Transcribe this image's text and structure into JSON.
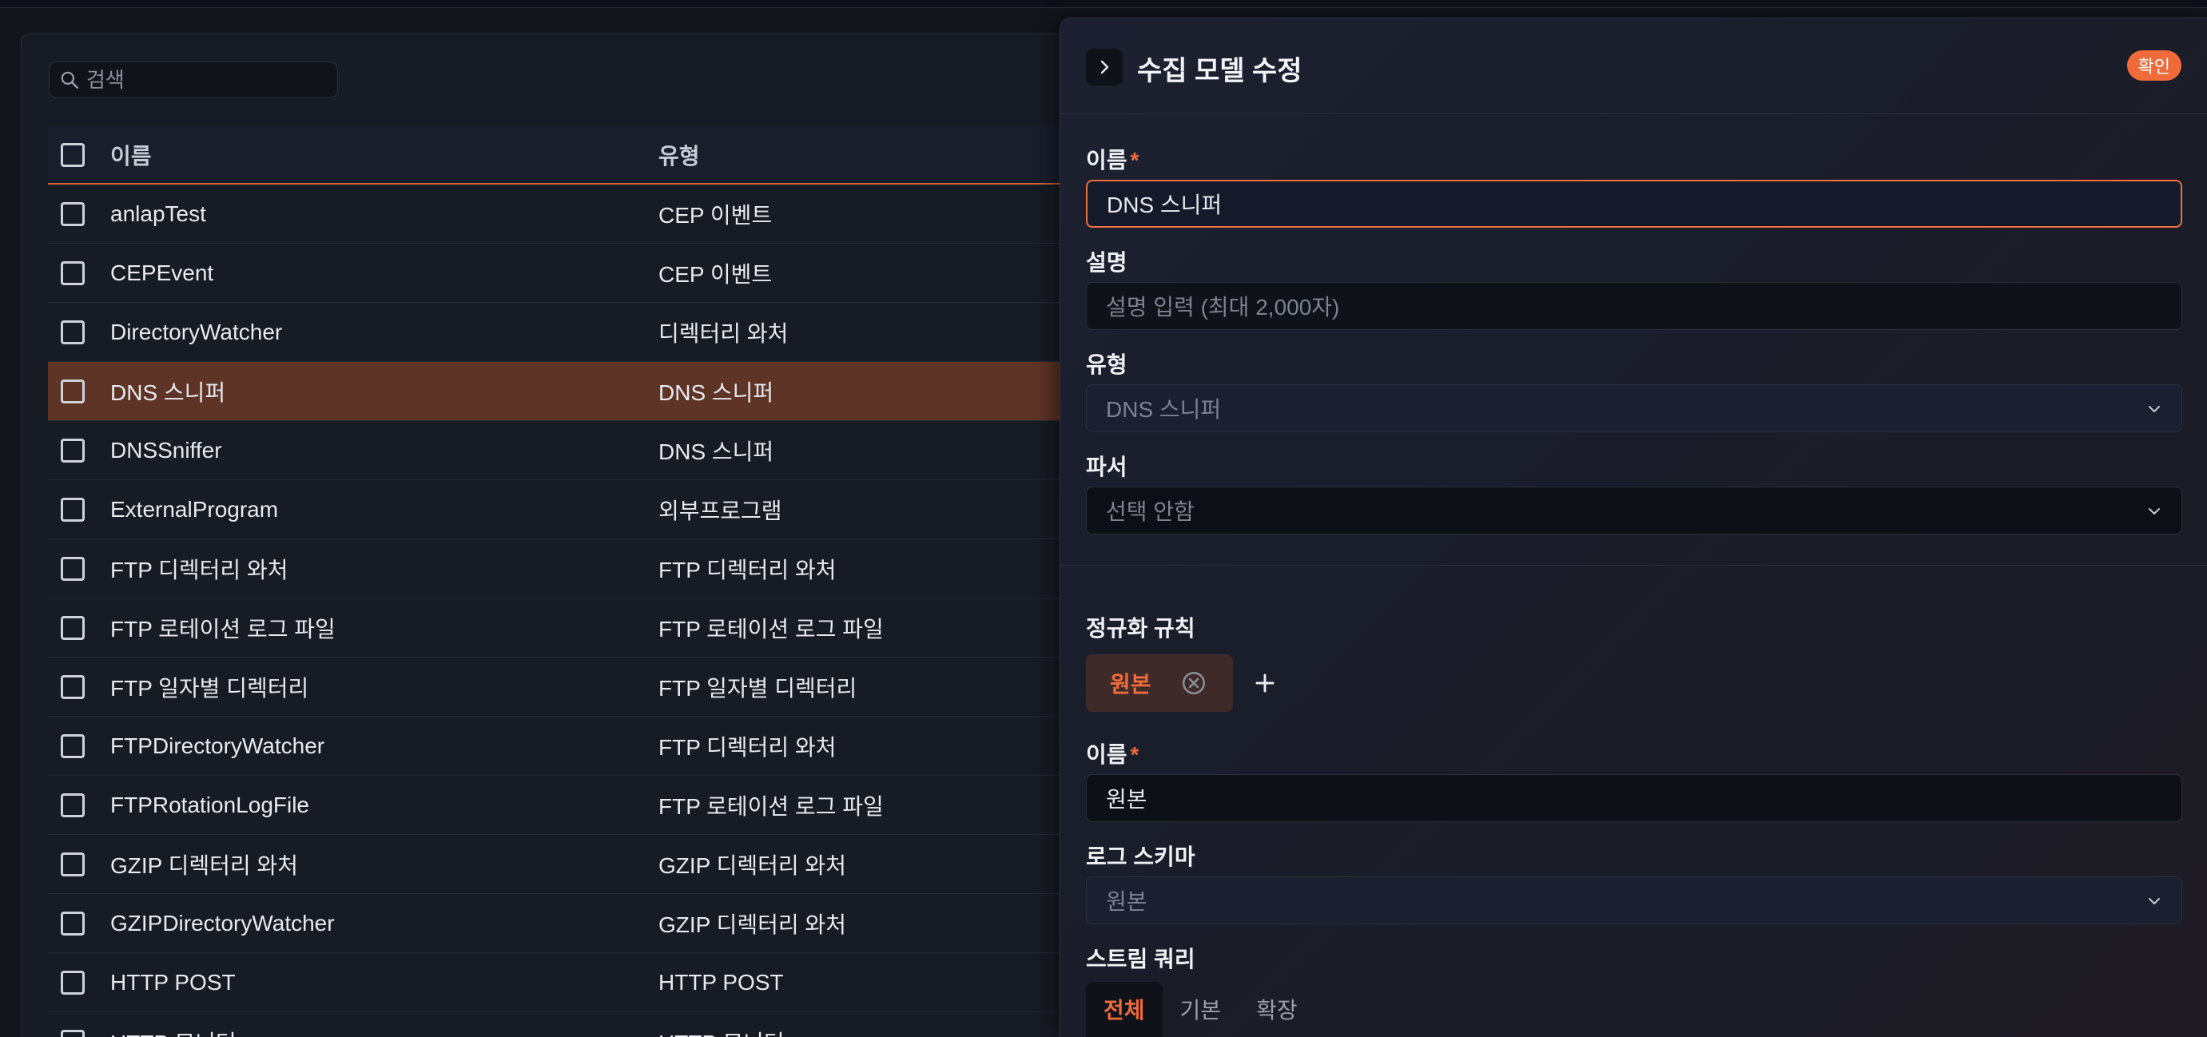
{
  "search": {
    "placeholder": "검색"
  },
  "table": {
    "columns": [
      "이름",
      "유형"
    ],
    "rows": [
      {
        "name": "anlapTest",
        "type": "CEP 이벤트"
      },
      {
        "name": "CEPEvent",
        "type": "CEP 이벤트"
      },
      {
        "name": "DirectoryWatcher",
        "type": "디렉터리 와처"
      },
      {
        "name": "DNS 스니퍼",
        "type": "DNS 스니퍼",
        "selected": true
      },
      {
        "name": "DNSSniffer",
        "type": "DNS 스니퍼"
      },
      {
        "name": "ExternalProgram",
        "type": "외부프로그램"
      },
      {
        "name": "FTP 디렉터리 와처",
        "type": "FTP 디렉터리 와처"
      },
      {
        "name": "FTP 로테이션 로그 파일",
        "type": "FTP 로테이션 로그 파일"
      },
      {
        "name": "FTP 일자별 디렉터리",
        "type": "FTP 일자별 디렉터리"
      },
      {
        "name": "FTPDirectoryWatcher",
        "type": "FTP 디렉터리 와처"
      },
      {
        "name": "FTPRotationLogFile",
        "type": "FTP 로테이션 로그 파일"
      },
      {
        "name": "GZIP 디렉터리 와처",
        "type": "GZIP 디렉터리 와처"
      },
      {
        "name": "GZIPDirectoryWatcher",
        "type": "GZIP 디렉터리 와처"
      },
      {
        "name": "HTTP POST",
        "type": "HTTP POST"
      },
      {
        "name": "HTTP 모니터",
        "type": "HTTP 모니터"
      }
    ]
  },
  "drawer": {
    "title": "수집 모델 수정",
    "confirm_label": "확인",
    "name_label": "이름",
    "required_mark": "*",
    "name_value": "DNS 스니퍼",
    "description_label": "설명",
    "description_placeholder": "설명 입력 (최대 2,000자)",
    "type_label": "유형",
    "type_value": "DNS 스니퍼",
    "parser_label": "파서",
    "parser_value": "선택 안함",
    "normalization_label": "정규화 규칙",
    "rule_chip_label": "원본",
    "rule_name_label": "이름",
    "rule_name_value": "원본",
    "log_schema_label": "로그 스키마",
    "log_schema_value": "원본",
    "stream_query_label": "스트림 쿼리",
    "tabs": [
      "전체",
      "기본",
      "확장"
    ]
  },
  "colors": {
    "accent": "#f06a3a",
    "selected_row": "#5e3426"
  }
}
